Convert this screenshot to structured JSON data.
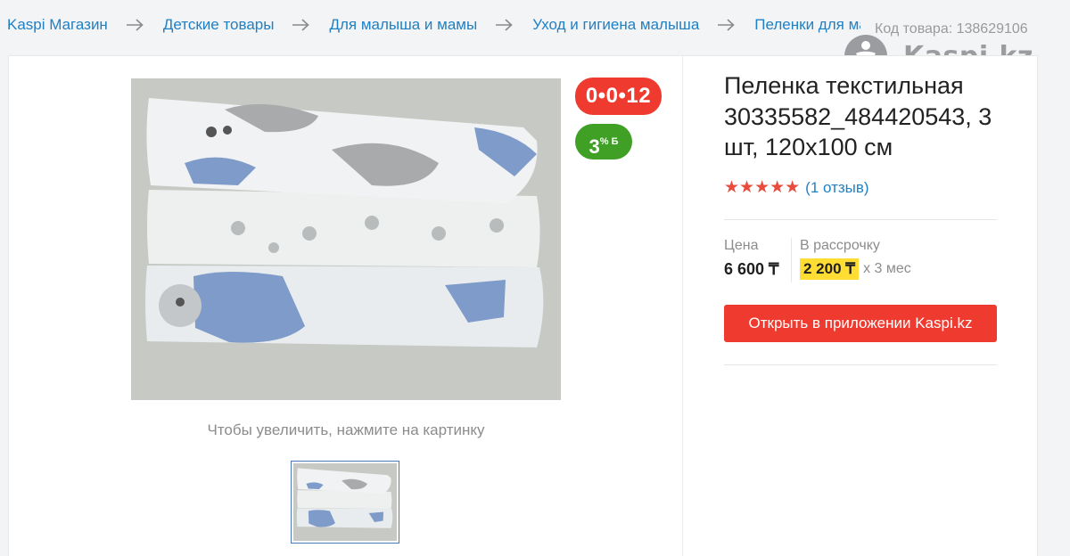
{
  "breadcrumb": {
    "items": [
      {
        "label": "Kaspi Магазин"
      },
      {
        "label": "Детские товары"
      },
      {
        "label": "Для малыша и мамы"
      },
      {
        "label": "Уход и гигиена малыша"
      },
      {
        "label": "Пеленки для малыша"
      }
    ]
  },
  "header": {
    "sku": "Код товара: 138629106",
    "brand_name": "Kaspi.kz"
  },
  "gallery": {
    "zoom_hint": "Чтобы увеличить, нажмите на картинку"
  },
  "badges": {
    "installment": "0•0•12",
    "bonus_value": "3",
    "bonus_suffix": "% Б"
  },
  "product": {
    "title": "Пеленка текстильная 30335582_484420543, 3 шт, 120х100 см",
    "stars": "★★★★★",
    "rating": 5,
    "reviews": "(1 отзыв)"
  },
  "price": {
    "label": "Цена",
    "value": "6 600 ₸",
    "installment_label": "В рассрочку",
    "installment_amount": "2 200 ₸",
    "installment_term": "х 3 мес"
  },
  "actions": {
    "open_app": "Открыть в приложении Kaspi.kz"
  },
  "colors": {
    "accent_red": "#ef3b2f",
    "link_blue": "#1f80c4",
    "bonus_green": "#3fa025",
    "highlight_yellow": "#ffdd33"
  }
}
